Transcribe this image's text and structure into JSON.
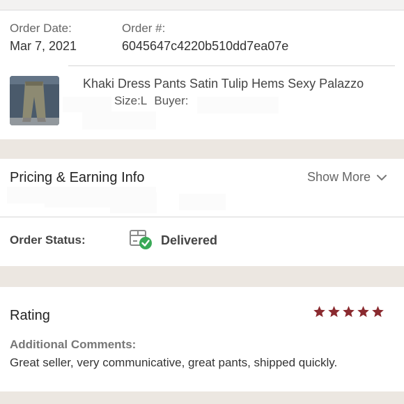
{
  "order": {
    "date_label": "Order Date:",
    "date_value": "Mar 7, 2021",
    "number_label": "Order #:",
    "number_value": "6045647c4220b510dd7ea07e"
  },
  "item": {
    "title": "Khaki Dress Pants Satin Tulip Hems Sexy Palazzo",
    "size_label": "Size:L",
    "buyer_label": "Buyer:"
  },
  "pricing": {
    "title": "Pricing & Earning Info",
    "show_more": "Show More"
  },
  "status": {
    "label": "Order Status:",
    "value": "Delivered",
    "icon": "package-delivered-icon"
  },
  "rating": {
    "title": "Rating",
    "stars": 5,
    "max_stars": 5,
    "star_color": "#8a2a2f",
    "comments_label": "Additional Comments:",
    "comments_text": "Great seller, very communicative, great pants, shipped quickly."
  },
  "colors": {
    "check_green": "#3aa957",
    "background_band": "#ece7e1"
  }
}
